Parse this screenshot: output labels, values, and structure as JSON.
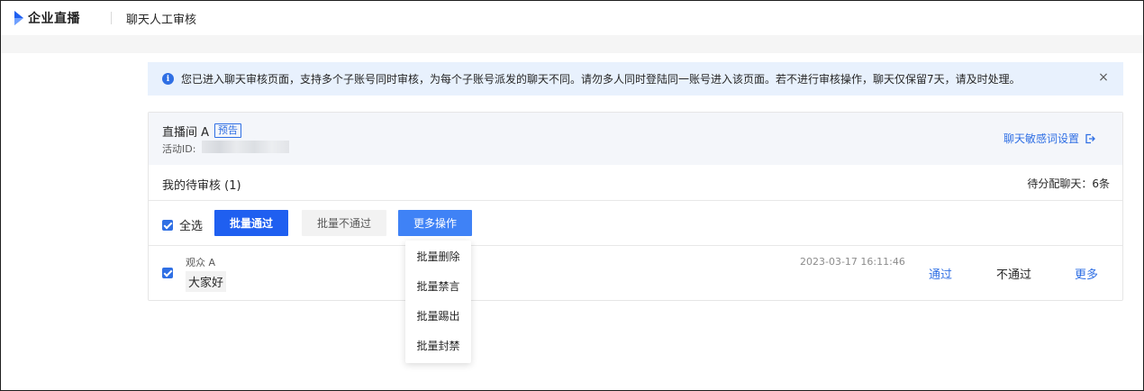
{
  "app": {
    "brand_name": "企业直播",
    "page_title": "聊天人工审核",
    "brand_color": "#1f5ff0"
  },
  "notice": {
    "text": "您已进入聊天审核页面，支持多个子账号同时审核，为每个子账号派发的聊天不同。请勿多人同时登陆同一账号进入该页面。若不进行审核操作，聊天仅保留7天，请及时处理。",
    "close_label": "×",
    "icon": "info-icon"
  },
  "room": {
    "name": "直播间 A",
    "badge": "预告",
    "activity_label": "活动ID:",
    "sensitive_link": "聊天敏感词设置"
  },
  "pending": {
    "title": "我的待审核 (1)",
    "unassigned": "待分配聊天：6条"
  },
  "actions": {
    "select_all": "全选",
    "batch_pass": "批量通过",
    "batch_reject": "批量不通过",
    "more_ops": "更多操作"
  },
  "messages": [
    {
      "viewer": "观众 A",
      "text": "大家好",
      "time": "2023-03-17 16:11:46",
      "pass": "通过",
      "reject": "不通过",
      "more": "更多"
    }
  ],
  "dropdown": {
    "items": [
      "批量删除",
      "批量禁言",
      "批量踢出",
      "批量封禁"
    ]
  }
}
